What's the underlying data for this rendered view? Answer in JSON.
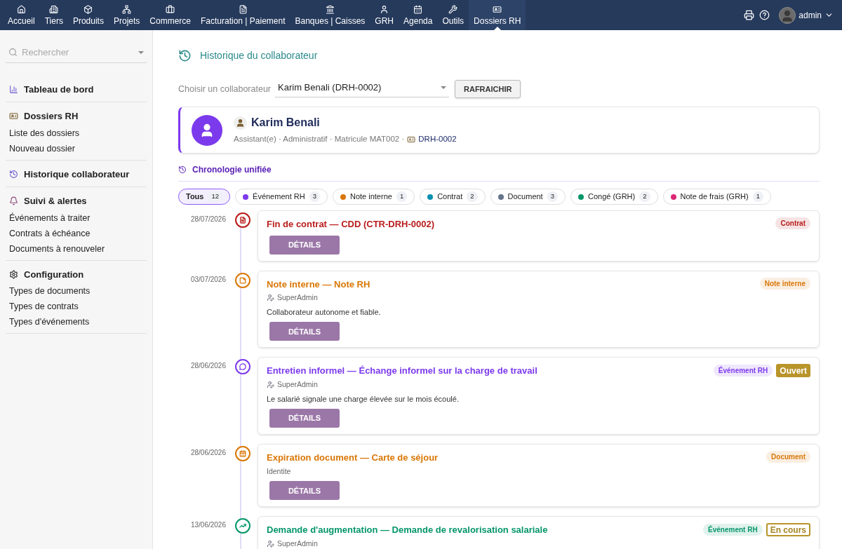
{
  "topnav": {
    "items": [
      {
        "label": "Accueil",
        "selected": false
      },
      {
        "label": "Tiers",
        "selected": false
      },
      {
        "label": "Produits",
        "selected": false
      },
      {
        "label": "Projets",
        "selected": false
      },
      {
        "label": "Commerce",
        "selected": false
      },
      {
        "label": "Facturation | Paiement",
        "selected": false
      },
      {
        "label": "Banques | Caisses",
        "selected": false
      },
      {
        "label": "GRH",
        "selected": false
      },
      {
        "label": "Agenda",
        "selected": false
      },
      {
        "label": "Outils",
        "selected": false
      },
      {
        "label": "Dossiers RH",
        "selected": true
      }
    ],
    "user": "admin"
  },
  "sidebar": {
    "search_placeholder": "Rechercher",
    "sections": [
      {
        "title": "Tableau de bord"
      },
      {
        "title": "Dossiers RH",
        "items": [
          "Liste des dossiers",
          "Nouveau dossier"
        ]
      },
      {
        "title": "Historique collaborateur"
      },
      {
        "title": "Suivi & alertes",
        "items": [
          "Événements à traiter",
          "Contrats à échéance",
          "Documents à renouveler"
        ]
      },
      {
        "title": "Configuration",
        "items": [
          "Types de documents",
          "Types de contrats",
          "Types d'événements"
        ]
      }
    ]
  },
  "page": {
    "title": "Historique du collaborateur",
    "selector_label": "Choisir un collaborateur",
    "selector_value": "Karim Benali (DRH-0002)",
    "refresh_button": "RAFRAICHIR"
  },
  "profile": {
    "name": "Karim Benali",
    "meta": "Assistant(e) · Administratif · Matricule MAT002 ·",
    "reference": "DRH-0002"
  },
  "timeline": {
    "title": "Chronologie unifiée",
    "filters": [
      {
        "label": "Tous",
        "count": "12",
        "selected": true
      },
      {
        "label": "Événement RH",
        "count": "3",
        "color": "#7c3aed",
        "selected": false
      },
      {
        "label": "Note interne",
        "count": "1",
        "color": "#d97706",
        "selected": false
      },
      {
        "label": "Contrat",
        "count": "2",
        "color": "#0891b2",
        "selected": false
      },
      {
        "label": "Document",
        "count": "3",
        "color": "#64748b",
        "selected": false
      },
      {
        "label": "Congé (GRH)",
        "count": "2",
        "color": "#059669",
        "selected": false
      },
      {
        "label": "Note de frais (GRH)",
        "count": "1",
        "color": "#db2777",
        "selected": false
      }
    ],
    "events": [
      {
        "date": "28/07/2026",
        "color": "#b91c1c",
        "title": "Fin de contrat — CDD (CTR-DRH-0002)",
        "tag": "Contrat",
        "button": "DÉTAILS"
      },
      {
        "date": "03/07/2026",
        "color": "#d97706",
        "title": "Note interne — Note RH",
        "author": "SuperAdmin",
        "description": "Collaborateur autonome et fiable.",
        "tag": "Note interne",
        "button": "DÉTAILS"
      },
      {
        "date": "28/06/2026",
        "color": "#7c3aed",
        "title": "Entretien informel — Échange informel sur la charge de travail",
        "author": "SuperAdmin",
        "description": "Le salarié signale une charge élevée sur le mois écoulé.",
        "tag": "Événement RH",
        "status": {
          "label": "Ouvert",
          "kind": "filled"
        },
        "button": "DÉTAILS"
      },
      {
        "date": "28/06/2026",
        "color": "#d97706",
        "title": "Expiration document — Carte de séjour",
        "subtitle": "Identite",
        "tag": "Document",
        "button": "DÉTAILS"
      },
      {
        "date": "13/06/2026",
        "color": "#059669",
        "title": "Demande d'augmentation — Demande de revalorisation salariale",
        "author": "SuperAdmin",
        "tag": "Événement RH",
        "status": {
          "label": "En cours",
          "kind": "outline"
        }
      }
    ]
  }
}
